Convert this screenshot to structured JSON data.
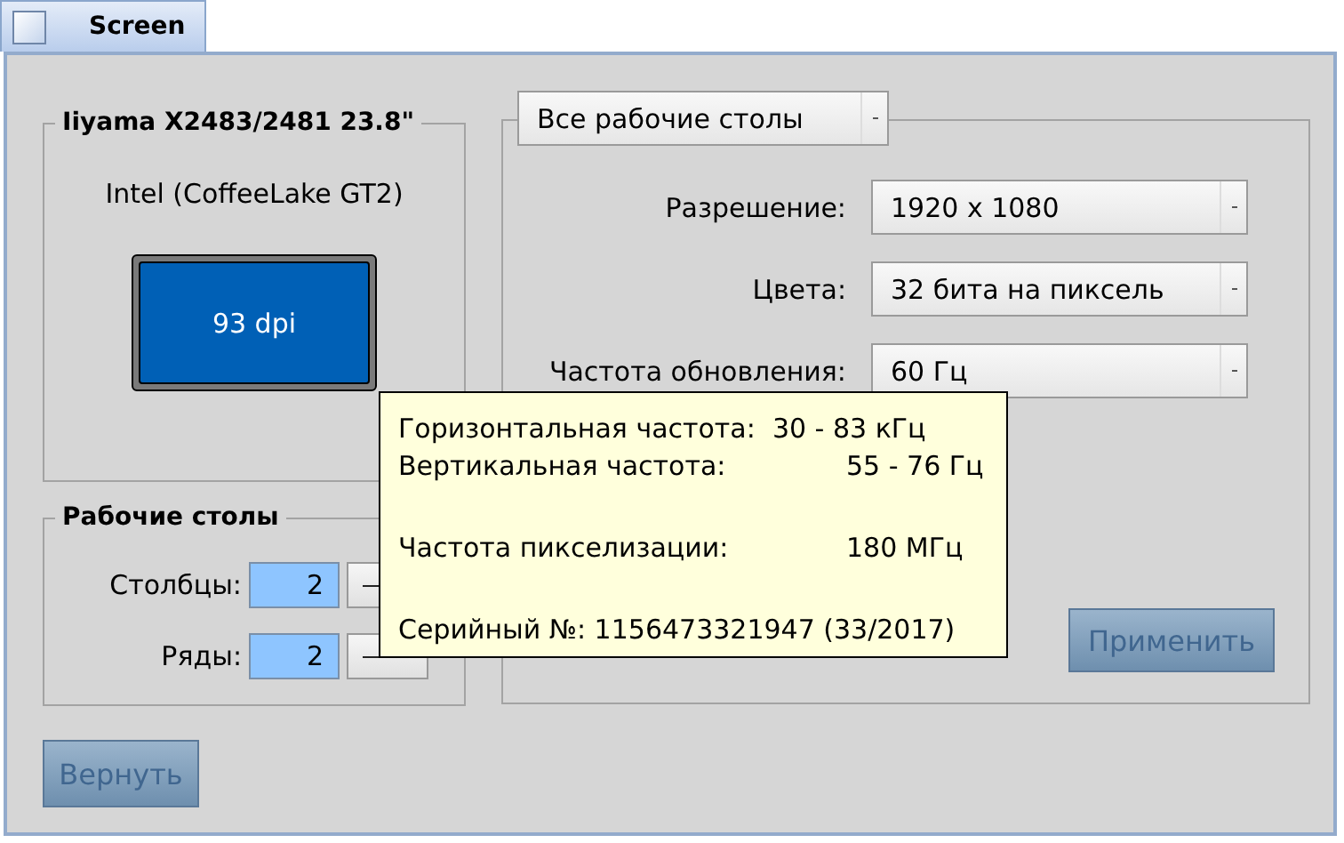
{
  "tab": {
    "label": "Screen",
    "selected": true
  },
  "monitor": {
    "title": "Iiyama X2483/2481 23.8\"",
    "adapter": "Intel (CoffeeLake GT2)",
    "dpi": "93 dpi"
  },
  "desktops": {
    "title": "Рабочие столы",
    "fields": [
      {
        "label": "Столбцы:",
        "value": "2"
      },
      {
        "label": "Ряды:",
        "value": "2"
      }
    ]
  },
  "scope": {
    "value": "Все рабочие столы"
  },
  "settings": [
    {
      "label": "Разрешение:",
      "value": "1920 x 1080"
    },
    {
      "label": "Цвета:",
      "value": "32 бита на пиксель"
    },
    {
      "label": "Частота обновления:",
      "value": "60 Гц"
    }
  ],
  "tooltip": {
    "sections": [
      {
        "lines": [
          {
            "text": "Горизонтальная частота:  30 - 83 кГц"
          },
          {
            "label": "Вертикальная частота:",
            "value": "55 - 76 Гц"
          }
        ]
      },
      {
        "lines": [
          {
            "label": "Частота пикселизации:",
            "value": "180 МГц"
          }
        ]
      },
      {
        "lines": [
          {
            "text": "Серийный №: 1156473321947 (33/2017)"
          }
        ]
      }
    ]
  },
  "apply_button": {
    "label": "Применить",
    "disabled": true
  },
  "revert_button": {
    "label": "Вернуть",
    "disabled": true
  }
}
